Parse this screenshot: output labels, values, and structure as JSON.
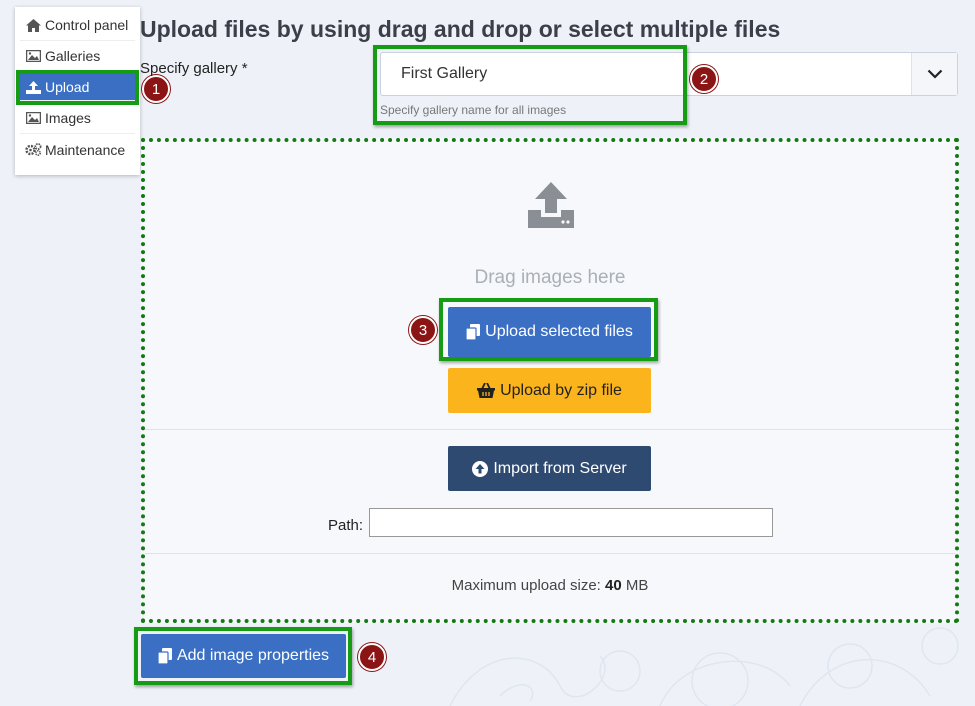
{
  "sidebar": {
    "items": [
      {
        "label": "Control panel",
        "icon": "home-icon"
      },
      {
        "label": "Galleries",
        "icon": "image-icon"
      },
      {
        "label": "Upload",
        "icon": "upload-icon",
        "active": true
      },
      {
        "label": "Images",
        "icon": "image-icon"
      },
      {
        "label": "Maintenance",
        "icon": "gears-icon"
      }
    ]
  },
  "page": {
    "title": "Upload files by using drag and drop or select multiple files",
    "gallery_label": "Specify gallery *",
    "gallery_value": "First Gallery",
    "gallery_hint": "Specify gallery name for all images"
  },
  "dropzone": {
    "drag_text": "Drag images here",
    "upload_selected_label": "Upload selected files",
    "upload_zip_label": "Upload by zip file",
    "import_server_label": "Import from Server",
    "path_label": "Path:",
    "path_value": "",
    "max_size_prefix": "Maximum upload size:",
    "max_size_value": "40",
    "max_size_unit": "MB"
  },
  "footer": {
    "add_properties_label": "Add image properties"
  },
  "badges": [
    "1",
    "2",
    "3",
    "4"
  ],
  "colors": {
    "primary": "#3a6fc4",
    "warning": "#fbb41c",
    "dark": "#2f4a70",
    "highlight": "#169c14",
    "badge": "#8b1515"
  }
}
